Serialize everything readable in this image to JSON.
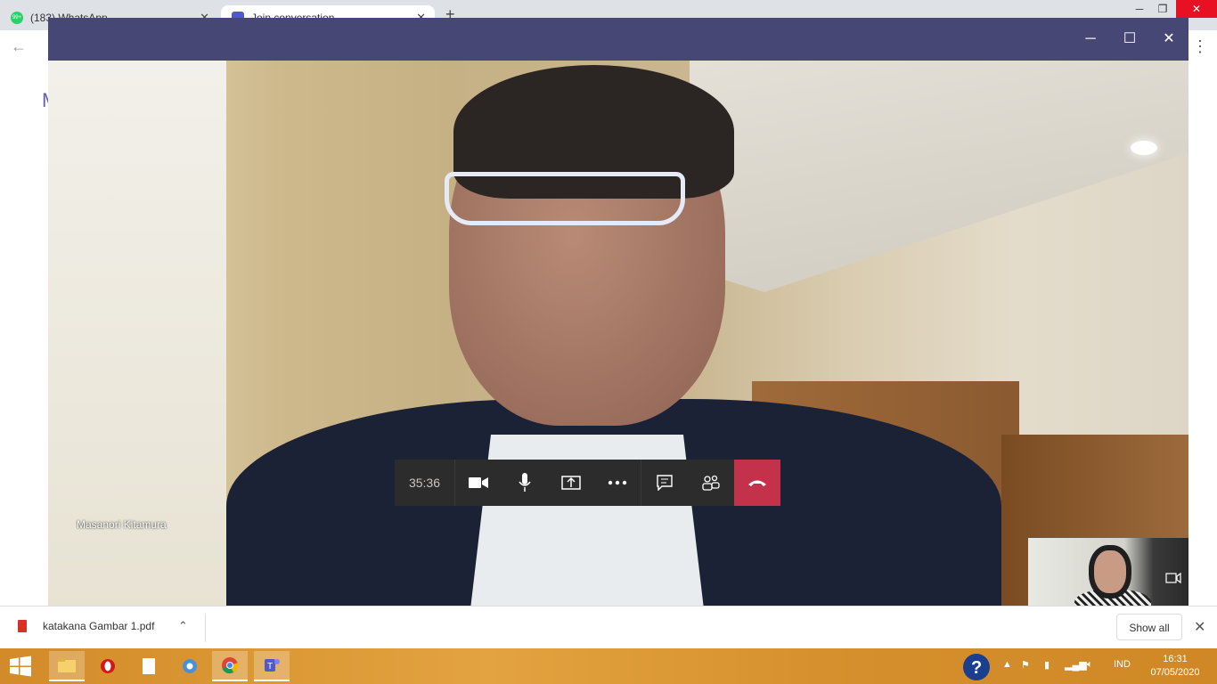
{
  "browser": {
    "tabs": [
      {
        "label": "(183) WhatsApp",
        "favicon_badge": "99+",
        "favicon_color": "#25d366"
      },
      {
        "label": "Join conversation",
        "favicon_color": "#5059c9"
      }
    ],
    "window_controls": {
      "minimize": "─",
      "restore": "❐",
      "close": "✕"
    },
    "page_heading_fragment": "M"
  },
  "teams": {
    "title_bar_color": "#464775",
    "window_controls": {
      "minimize": "─",
      "maximize": "☐",
      "close": "✕"
    },
    "caller_name": "Masanori Kitamura",
    "call_timer": "35:36",
    "controls": [
      {
        "name": "camera",
        "icon": "video-camera-icon"
      },
      {
        "name": "microphone",
        "icon": "microphone-icon"
      },
      {
        "name": "share",
        "icon": "share-screen-icon"
      },
      {
        "name": "more",
        "icon": "more-options-icon"
      },
      {
        "name": "chat",
        "icon": "chat-icon"
      },
      {
        "name": "participants",
        "icon": "participants-icon"
      },
      {
        "name": "hang-up",
        "icon": "hang-up-icon",
        "color": "#c4314b"
      }
    ]
  },
  "downloads": {
    "file_name": "katakana Gambar 1.pdf",
    "show_all": "Show all"
  },
  "taskbar": {
    "language": "IND",
    "time": "16:31",
    "date": "07/05/2020"
  }
}
